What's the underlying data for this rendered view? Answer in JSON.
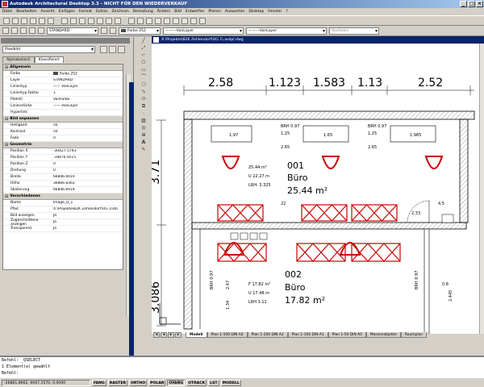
{
  "window": {
    "title": "Autodesk Architectural Desktop 3.3 - NICHT FÜR DEN WIEDERVERKAUF"
  },
  "menu": [
    "Datei",
    "Bearbeiten",
    "Ansicht",
    "Einfügen",
    "Format",
    "Extras",
    "Zeichnen",
    "Bemaßung",
    "Ändern",
    "Bild",
    "Entwerfen",
    "Planen",
    "Auswerten",
    "Desktop",
    "Fenster",
    "?"
  ],
  "toolbar": {
    "layer_value": "STANDARD",
    "color_value": "Farbe 252",
    "linetype_value": "VonLayer",
    "lineweight_value": "VonLayer",
    "plotstyle_value": "VonFarbe"
  },
  "palette": {
    "object_type": "Pixelbild",
    "tabs": [
      "Alphabetisch",
      "Klassifiziert"
    ],
    "active_tab": "Klassifiziert",
    "categories": [
      {
        "name": "Allgemein",
        "rows": [
          [
            "Farbe",
            "Farbe 252"
          ],
          [
            "Layer",
            "STANDARD"
          ],
          [
            "Linientyp",
            "—— VonLayer"
          ],
          [
            "Linientyp Faktor",
            "1"
          ],
          [
            "Plotstil",
            "VonFarbe"
          ],
          [
            "Linienstärke",
            "—— VonLayer"
          ],
          [
            "Hyperlink",
            ""
          ]
        ]
      },
      {
        "name": "Bild anpassen",
        "rows": [
          [
            "Helligkeit",
            "50"
          ],
          [
            "Kontrast",
            "50"
          ],
          [
            "Fade",
            "0"
          ]
        ]
      },
      {
        "name": "Geometrie",
        "rows": [
          [
            "Position X",
            "-30427.5793"
          ],
          [
            "Position Y",
            "-18476.9515"
          ],
          [
            "Position Z",
            "0"
          ],
          [
            "Drehung",
            "0"
          ],
          [
            "Breite",
            "66846.6919"
          ],
          [
            "Höhe",
            "36866.8363"
          ],
          [
            "Skalierung",
            "66846.6919"
          ]
        ]
      },
      {
        "name": "Verschiedenes",
        "rows": [
          [
            "Name",
            "Image_D_1"
          ],
          [
            "Pfad",
            "X:\\Projekte\\B2K Zehlendorf\\OG 1\\sb\\"
          ],
          [
            "Bild anzeigen",
            "Ja"
          ],
          [
            "Zugeschnittene anzeigen",
            "Ja"
          ],
          [
            "Transparenz",
            "Ja"
          ]
        ]
      }
    ]
  },
  "drawing": {
    "title": "X:\\Projekte\\B2K Zehlendorf\\OG 1\\.asdpl.dwg",
    "dims_top": [
      "2.58",
      "1.123",
      "1.583",
      "1.13",
      "2.52"
    ],
    "dim_left_1": "3.71",
    "dim_left_2": "3.086",
    "brh_labels": [
      "BRH 0.97",
      "BRH 0.97"
    ],
    "room1": {
      "number": "001",
      "name": "Büro",
      "area": "25.44 m²",
      "f": "25.44 m²",
      "u": "U 22.27 m",
      "lrh": "LRH: 3.325"
    },
    "room2": {
      "number": "002",
      "name": "Büro",
      "area": "17.82 m²",
      "f": "F 17.82 m²",
      "u": "U 17.48 m",
      "lrh": "LRH 3.11"
    },
    "window_labels": [
      "1.97",
      "1.25",
      "2.65",
      "1.65",
      "1.25",
      "2.65",
      "1.965"
    ],
    "misc_labels": [
      "22",
      "2.33",
      "4.5",
      "BRH 0.97",
      "2.47",
      "1.34",
      "BRH 0.97",
      "2.445",
      "0.8"
    ]
  },
  "layout_tabs": [
    "Modell",
    "Plan 1-500 DIN A2",
    "Plan 1-200 DIN A2",
    "Plan 1-100 DIN A1",
    "Plan 1-50 DIN A0",
    "Massenobjekte",
    "Raumplan"
  ],
  "active_layout": "Modell",
  "command": [
    "Befehl: _QSELECT",
    "1 Element(e) gewählt",
    "Befehl:"
  ],
  "status": {
    "coords": "-26881.8662, 6067.1570, 0.0000",
    "buttons": [
      "FANG",
      "RASTER",
      "ORTHO",
      "POLAR",
      "OFANG",
      "OTRACK",
      "LST",
      "MODELL"
    ]
  },
  "colors": {
    "accent": "#0a246a",
    "hatch": "#cc0000"
  }
}
